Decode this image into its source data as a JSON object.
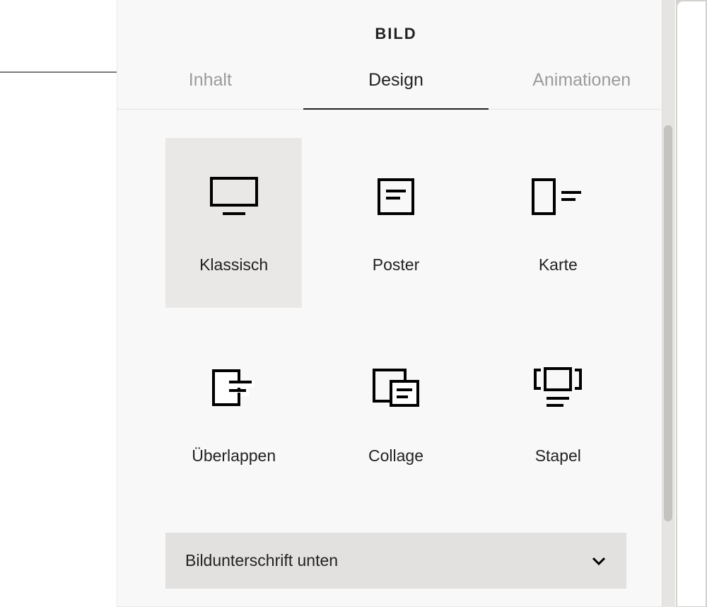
{
  "panel": {
    "title": "BILD",
    "tabs": [
      {
        "label": "Inhalt",
        "active": false
      },
      {
        "label": "Design",
        "active": true
      },
      {
        "label": "Animationen",
        "active": false
      }
    ]
  },
  "layouts": [
    {
      "id": "klassisch",
      "label": "Klassisch",
      "selected": true
    },
    {
      "id": "poster",
      "label": "Poster",
      "selected": false
    },
    {
      "id": "karte",
      "label": "Karte",
      "selected": false
    },
    {
      "id": "ueberlappen",
      "label": "Überlappen",
      "selected": false
    },
    {
      "id": "collage",
      "label": "Collage",
      "selected": false
    },
    {
      "id": "stapel",
      "label": "Stapel",
      "selected": false
    }
  ],
  "dropdown": {
    "caption_position": {
      "selected": "Bildunterschrift unten"
    }
  }
}
